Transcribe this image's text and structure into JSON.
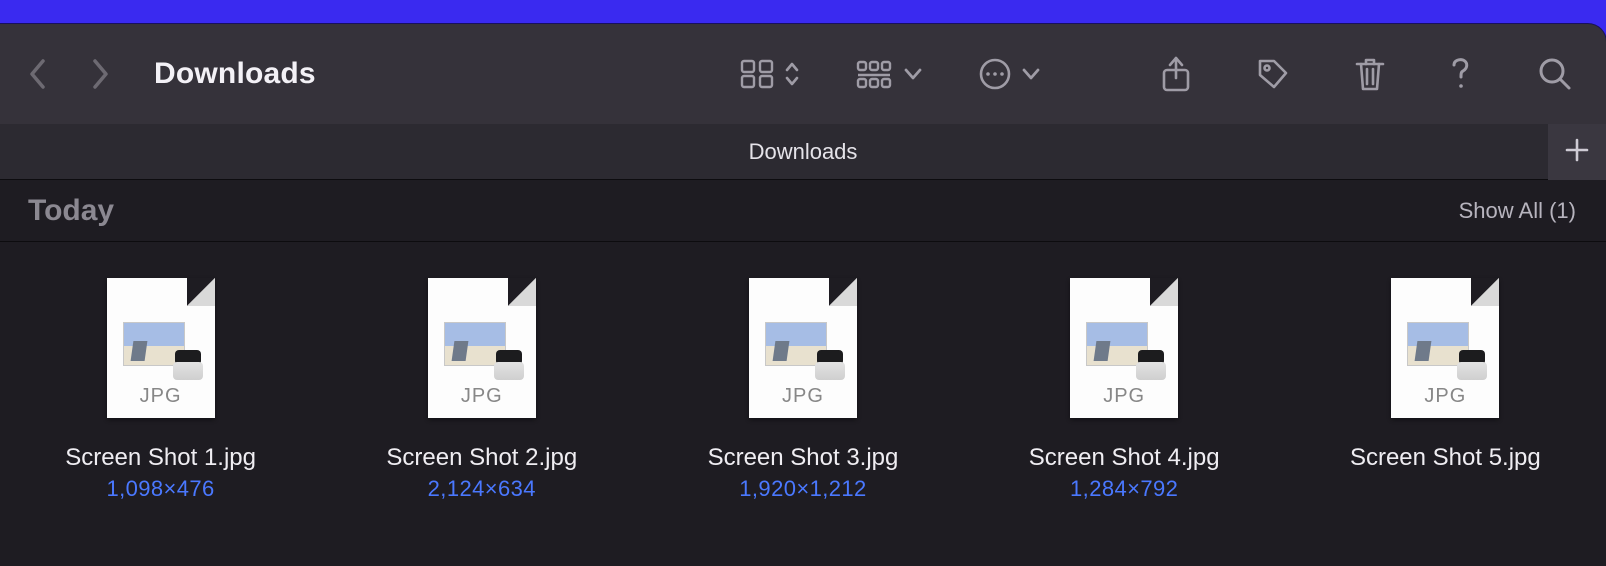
{
  "window": {
    "title": "Downloads",
    "tab_label": "Downloads"
  },
  "section": {
    "title": "Today",
    "show_all_label": "Show All (1)"
  },
  "files": [
    {
      "name": "Screen Shot 1.jpg",
      "dims": "1,098×476",
      "type_label": "JPG"
    },
    {
      "name": "Screen Shot 2.jpg",
      "dims": "2,124×634",
      "type_label": "JPG"
    },
    {
      "name": "Screen Shot 3.jpg",
      "dims": "1,920×1,212",
      "type_label": "JPG"
    },
    {
      "name": "Screen Shot 4.jpg",
      "dims": "1,284×792",
      "type_label": "JPG"
    },
    {
      "name": "Screen Shot 5.jpg",
      "dims": "",
      "type_label": "JPG"
    }
  ]
}
